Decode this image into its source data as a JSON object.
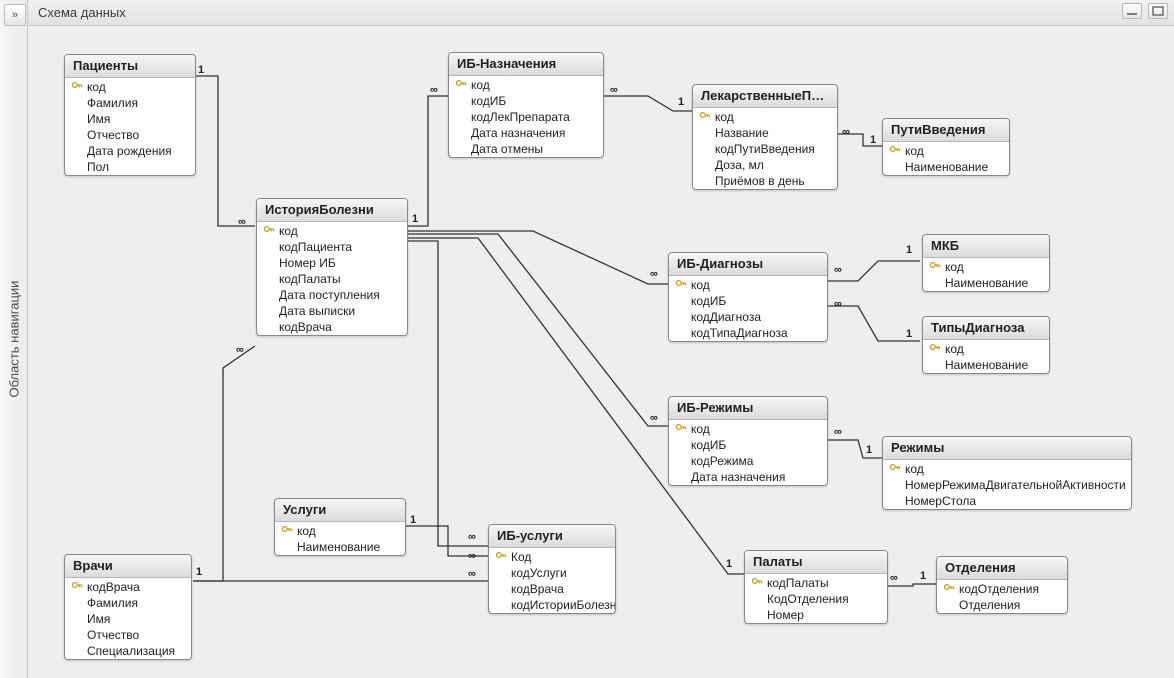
{
  "window": {
    "title": "Схема данных",
    "nav_expand_glyph": "»",
    "nav_panel_label": "Область навигации"
  },
  "cardinality": {
    "one": "1",
    "many": "∞"
  },
  "tables": {
    "patients": {
      "title": "Пациенты",
      "fields": [
        {
          "name": "код",
          "pk": true
        },
        {
          "name": "Фамилия"
        },
        {
          "name": "Имя"
        },
        {
          "name": "Отчество"
        },
        {
          "name": "Дата рождения"
        },
        {
          "name": "Пол"
        }
      ]
    },
    "doctors": {
      "title": "Врачи",
      "fields": [
        {
          "name": "кодВрача",
          "pk": true
        },
        {
          "name": "Фамилия"
        },
        {
          "name": "Имя"
        },
        {
          "name": "Отчество"
        },
        {
          "name": "Специализация"
        }
      ]
    },
    "history": {
      "title": "ИсторияБолезни",
      "fields": [
        {
          "name": "код",
          "pk": true
        },
        {
          "name": "кодПациента"
        },
        {
          "name": "Номер ИБ"
        },
        {
          "name": "кодПалаты"
        },
        {
          "name": "Дата поступления"
        },
        {
          "name": "Дата выписки"
        },
        {
          "name": "кодВрача"
        }
      ]
    },
    "services": {
      "title": "Услуги",
      "fields": [
        {
          "name": "код",
          "pk": true
        },
        {
          "name": "Наименование"
        }
      ]
    },
    "ib_services": {
      "title": "ИБ-услуги",
      "fields": [
        {
          "name": "Код",
          "pk": true
        },
        {
          "name": "кодУслуги"
        },
        {
          "name": "кодВрача"
        },
        {
          "name": "кодИсторииБолезни"
        }
      ]
    },
    "ib_prescriptions": {
      "title": "ИБ-Назначения",
      "fields": [
        {
          "name": "код",
          "pk": true
        },
        {
          "name": "кодИБ"
        },
        {
          "name": "кодЛекПрепарата"
        },
        {
          "name": "Дата назначения"
        },
        {
          "name": "Дата отмены"
        }
      ]
    },
    "drugs": {
      "title": "ЛекарственныеПр...",
      "fields": [
        {
          "name": "код",
          "pk": true
        },
        {
          "name": "Название"
        },
        {
          "name": "кодПутиВведения"
        },
        {
          "name": "Доза, мл"
        },
        {
          "name": "Приёмов в день"
        }
      ]
    },
    "routes": {
      "title": "ПутиВведения",
      "fields": [
        {
          "name": "код",
          "pk": true
        },
        {
          "name": "Наименование"
        }
      ]
    },
    "ib_diagnoses": {
      "title": "ИБ-Диагнозы",
      "fields": [
        {
          "name": "код",
          "pk": true
        },
        {
          "name": "кодИБ"
        },
        {
          "name": "кодДиагноза"
        },
        {
          "name": "кодТипаДиагноза"
        }
      ]
    },
    "mkb": {
      "title": "МКБ",
      "fields": [
        {
          "name": "код",
          "pk": true
        },
        {
          "name": "Наименование"
        }
      ]
    },
    "diagnosis_types": {
      "title": "ТипыДиагноза",
      "fields": [
        {
          "name": "код",
          "pk": true
        },
        {
          "name": "Наименование"
        }
      ]
    },
    "ib_modes": {
      "title": "ИБ-Режимы",
      "fields": [
        {
          "name": "код",
          "pk": true
        },
        {
          "name": "кодИБ"
        },
        {
          "name": "кодРежима"
        },
        {
          "name": "Дата назначения"
        }
      ]
    },
    "modes": {
      "title": "Режимы",
      "fields": [
        {
          "name": "код",
          "pk": true
        },
        {
          "name": "НомерРежимаДвигательнойАктивности"
        },
        {
          "name": "НомерСтола"
        }
      ]
    },
    "wards": {
      "title": "Палаты",
      "fields": [
        {
          "name": "кодПалаты",
          "pk": true
        },
        {
          "name": "КодОтделения"
        },
        {
          "name": "Номер"
        }
      ]
    },
    "departments": {
      "title": "Отделения",
      "fields": [
        {
          "name": "кодОтделения",
          "pk": true
        },
        {
          "name": "Отделения"
        }
      ]
    }
  }
}
